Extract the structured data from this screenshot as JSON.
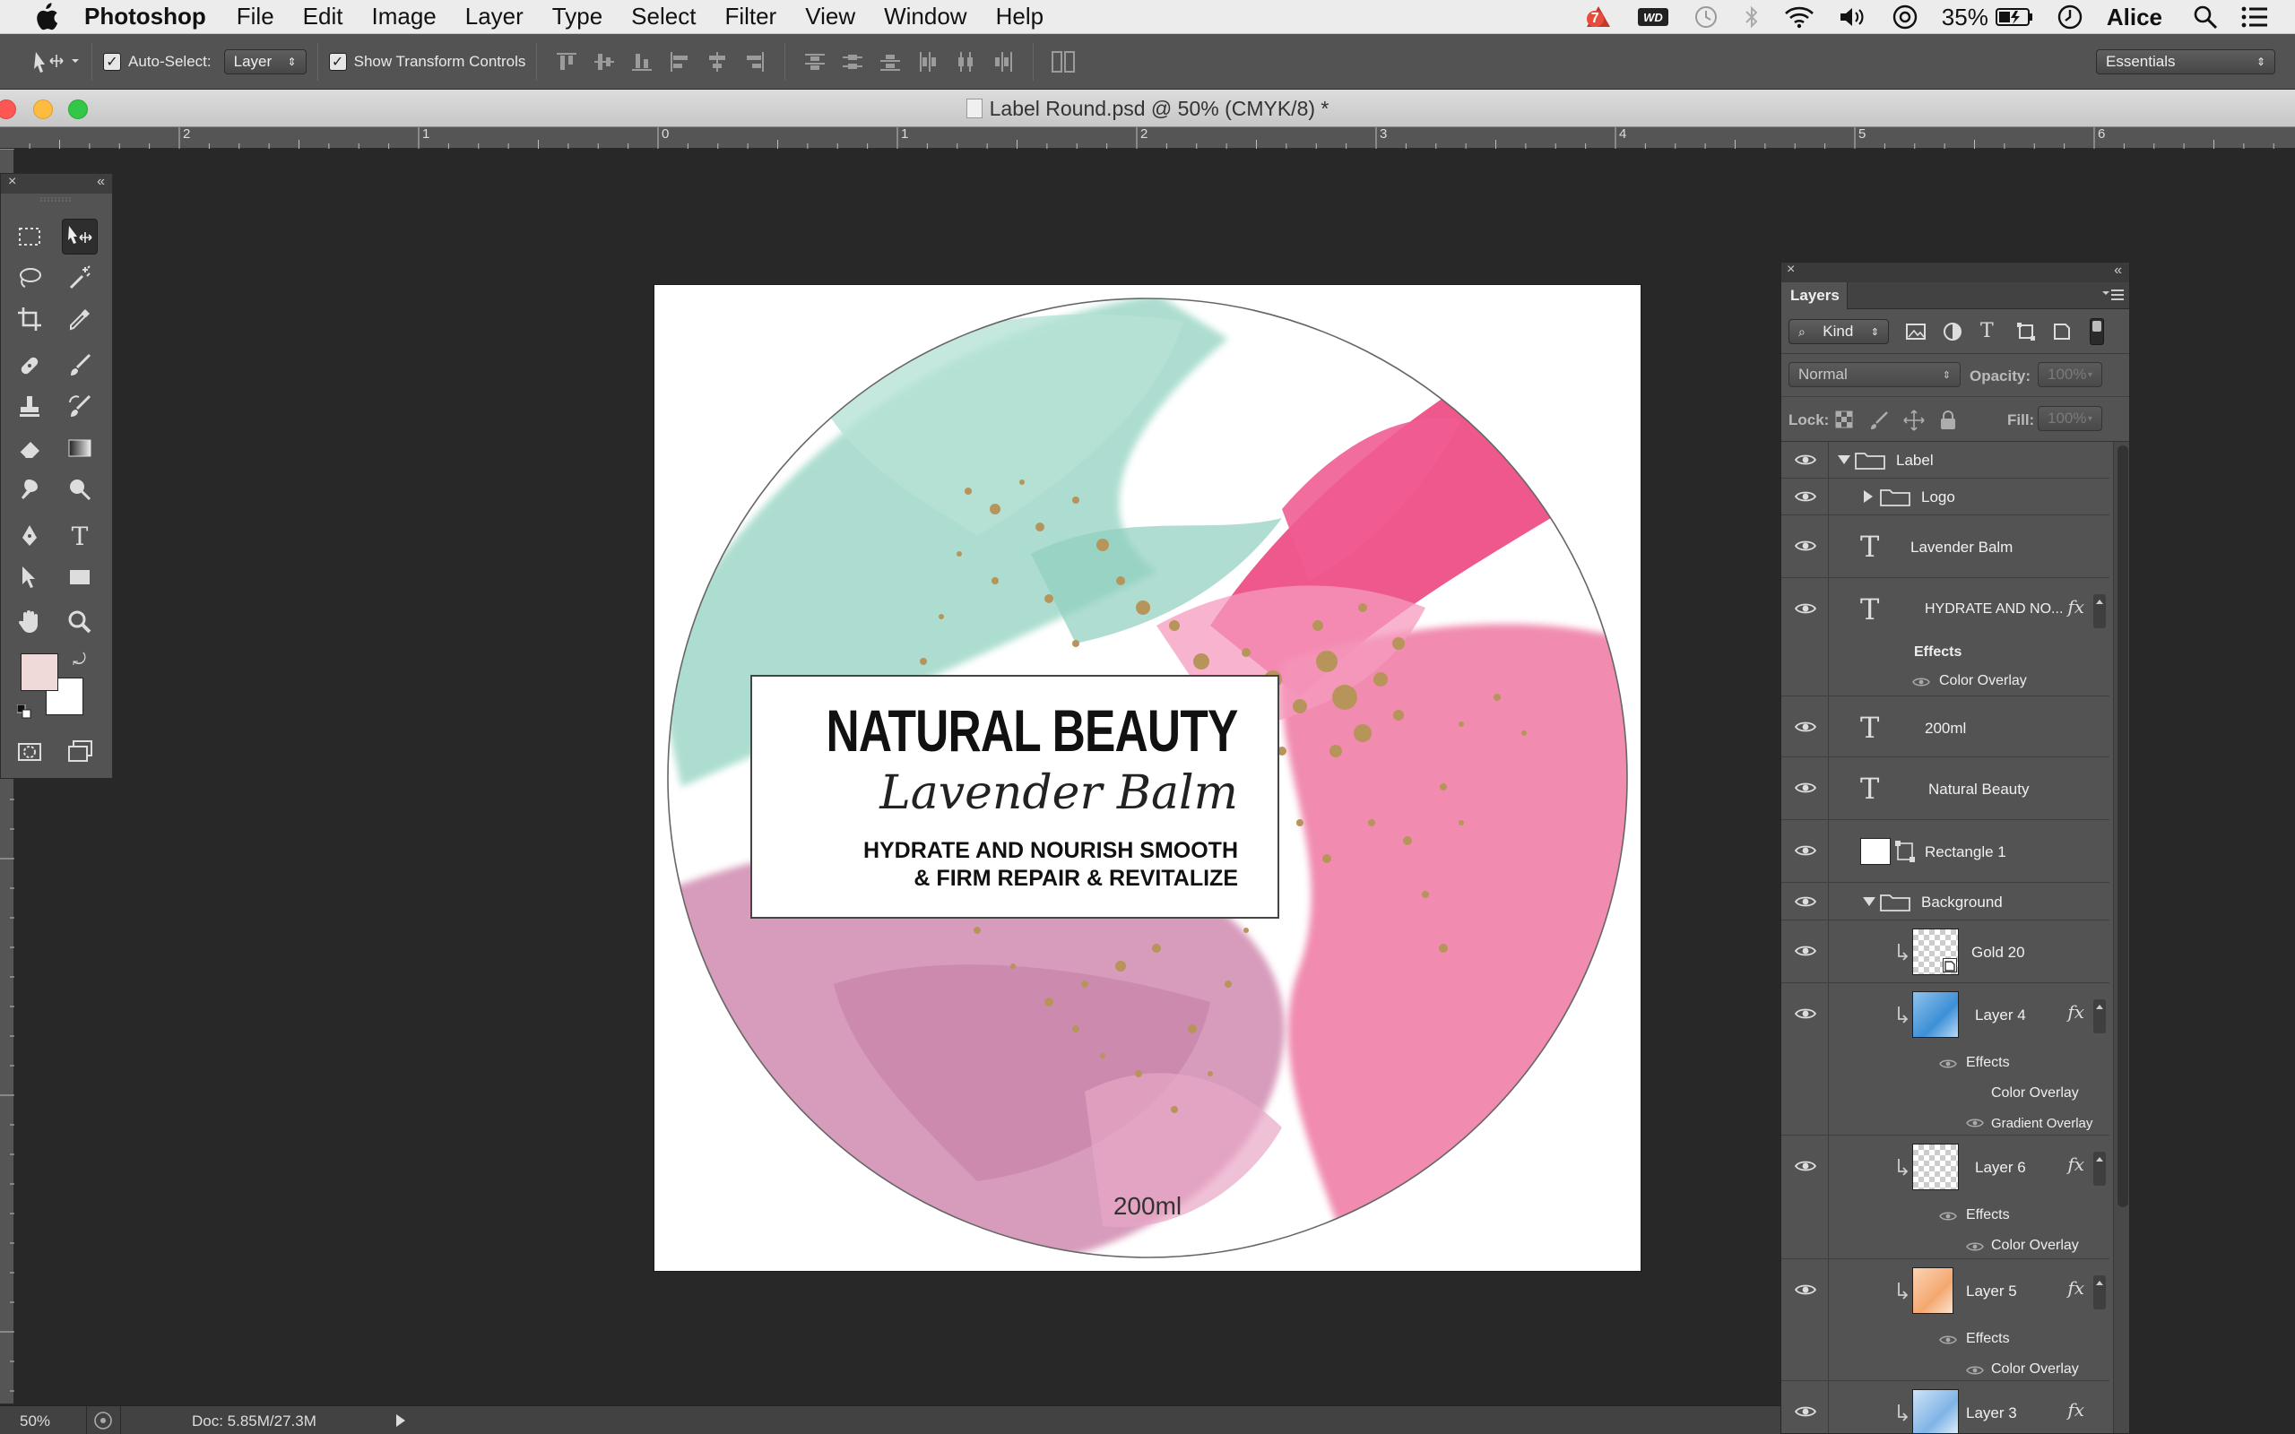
{
  "menubar": {
    "app_name": "Photoshop",
    "items": [
      "File",
      "Edit",
      "Image",
      "Layer",
      "Type",
      "Select",
      "Filter",
      "View",
      "Window",
      "Help"
    ],
    "status": {
      "notification_badge": "7",
      "battery": "35%",
      "user": "Alice"
    }
  },
  "options_bar": {
    "auto_select_label": "Auto-Select:",
    "auto_select_value": "Layer",
    "show_transform_label": "Show Transform Controls",
    "workspace": "Essentials"
  },
  "document": {
    "title": "Label Round.psd @ 50% (CMYK/8) *",
    "ruler_labels": [
      "2",
      "1",
      "0",
      "1",
      "2",
      "3",
      "4",
      "5",
      "6"
    ]
  },
  "label_design": {
    "title": "NATURAL BEAUTY",
    "subtitle": "Lavender Balm",
    "tagline_line1": "HYDRATE AND NOURISH SMOOTH",
    "tagline_line2": "& FIRM REPAIR & REVITALIZE",
    "volume": "200ml",
    "colors": {
      "mint": "#9fd8c8",
      "pink": "#ee4f86",
      "light_pink": "#f07fa8",
      "mauve": "#d391b4",
      "gold": "#b7955a"
    }
  },
  "layers_panel": {
    "tab": "Layers",
    "filter_kind": "Kind",
    "blend_mode": "Normal",
    "opacity_label": "Opacity:",
    "opacity_value": "100%",
    "lock_label": "Lock:",
    "fill_label": "Fill:",
    "fill_value": "100%",
    "rows": {
      "label": "Label",
      "logo": "Logo",
      "lavender_balm": "Lavender Balm",
      "hydrate": "HYDRATE AND NO...",
      "hydrate_effects": "Effects",
      "hydrate_color_overlay": "Color Overlay",
      "ml": "200ml",
      "natural_beauty": "Natural Beauty",
      "rectangle": "Rectangle 1",
      "background": "Background",
      "gold": "Gold 20",
      "layer4": "Layer 4",
      "layer4_effects": "Effects",
      "layer4_color_overlay": "Color Overlay",
      "layer4_gradient_overlay": "Gradient Overlay",
      "layer6": "Layer 6",
      "layer6_effects": "Effects",
      "layer6_color_overlay": "Color Overlay",
      "layer5": "Layer 5",
      "layer5_effects": "Effects",
      "layer5_color_overlay": "Color Overlay",
      "layer3": "Layer 3"
    }
  },
  "status_bar": {
    "zoom": "50%",
    "doc_info": "Doc: 5.85M/27.3M"
  },
  "icons": [
    "apple-icon",
    "move-tool-icon",
    "marquee-icon",
    "lasso-icon",
    "magic-wand-icon",
    "crop-icon",
    "eyedropper-icon",
    "healing-icon",
    "brush-icon",
    "stamp-icon",
    "history-brush-icon",
    "eraser-icon",
    "gradient-icon",
    "smudge-icon",
    "dodge-icon",
    "pen-icon",
    "type-icon",
    "path-select-icon",
    "rectangle-icon",
    "hand-icon",
    "zoom-icon",
    "eye-icon",
    "folder-icon",
    "type-layer-icon"
  ]
}
